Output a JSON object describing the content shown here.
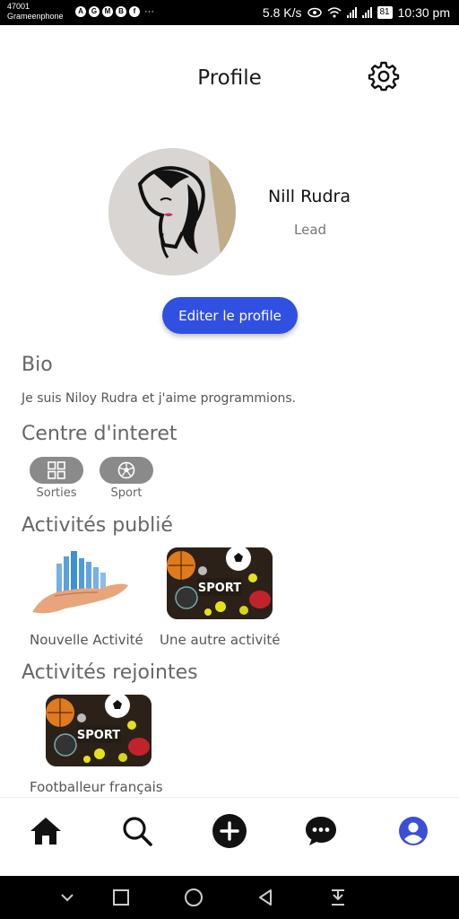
{
  "status_bar": {
    "carrier_line1": "47001",
    "carrier_line2": "Grameenphone",
    "app_icons": [
      "A",
      "G",
      "M",
      "B",
      "f"
    ],
    "more": "···",
    "speed": "5.8 K/s",
    "battery": "81",
    "time": "10:30 pm"
  },
  "header": {
    "title": "Profile",
    "settings_icon": "gear-icon"
  },
  "profile": {
    "name": "Nill Rudra",
    "role": "Lead",
    "edit_label": "Editer le profile"
  },
  "bio": {
    "title": "Bio",
    "text": "Je suis Niloy Rudra et j'aime programmions."
  },
  "interests": {
    "title": "Centre d'interet",
    "items": [
      {
        "label": "Sorties",
        "icon": "grid-icon"
      },
      {
        "label": "Sport",
        "icon": "soccer-ball-icon"
      }
    ]
  },
  "published": {
    "title": "Activités publié",
    "items": [
      {
        "caption": "Nouvelle Activité"
      },
      {
        "caption": "Une autre activité",
        "image_text": "SPORT"
      }
    ]
  },
  "joined": {
    "title": "Activités rejointes",
    "items": [
      {
        "caption": "Footballeur français",
        "image_text": "SPORT"
      }
    ]
  },
  "bottom_nav": [
    "home-icon",
    "search-icon",
    "add-icon",
    "chat-icon",
    "profile-icon"
  ],
  "colors": {
    "accent": "#2f50e0",
    "active_nav": "#3b4fd6"
  }
}
